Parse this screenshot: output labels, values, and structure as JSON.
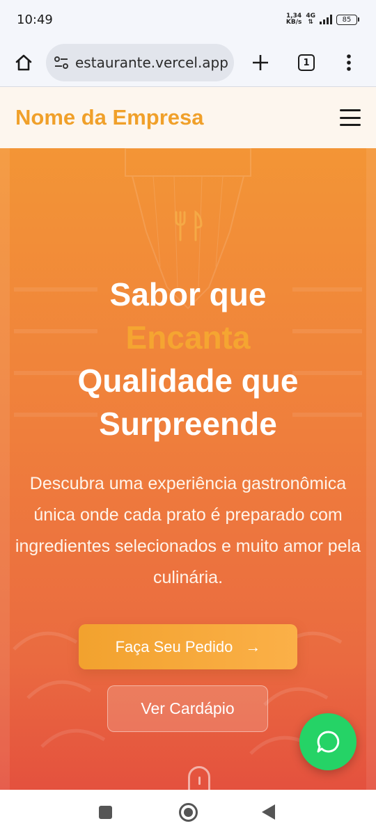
{
  "status_bar": {
    "time": "10:49",
    "net_speed_value": "1,34",
    "net_speed_unit": "KB/s",
    "net_type": "4G",
    "battery": "85"
  },
  "browser": {
    "url": "estaurante.vercel.app",
    "tab_count": "1",
    "icons": [
      "home-icon",
      "site-settings-icon",
      "plus-icon",
      "tabs-icon",
      "more-vert-icon"
    ]
  },
  "header": {
    "brand": "Nome da Empresa",
    "brand_color": "#f0a02a",
    "menu_icon": "hamburger-icon"
  },
  "hero": {
    "icon": "utensils-icon",
    "title_line1": "Sabor que",
    "title_accent": "Encanta",
    "title_line3": "Qualidade que",
    "title_line4": "Surpreende",
    "description": "Descubra uma experiência gastronômica única onde cada prato é preparado com ingredientes selecionados e muito amor pela culinária.",
    "primary_button": "Faça Seu Pedido",
    "primary_button_arrow": "→",
    "secondary_button": "Ver Cardápio",
    "accent_color": "#f5a531",
    "gradient_top": "#f39536",
    "gradient_bottom": "#e4513e"
  },
  "fab": {
    "icon": "whatsapp-icon",
    "color": "#25d366"
  },
  "nav_bar": {
    "icons": [
      "recents-square-icon",
      "home-circle-icon",
      "back-triangle-icon"
    ]
  }
}
